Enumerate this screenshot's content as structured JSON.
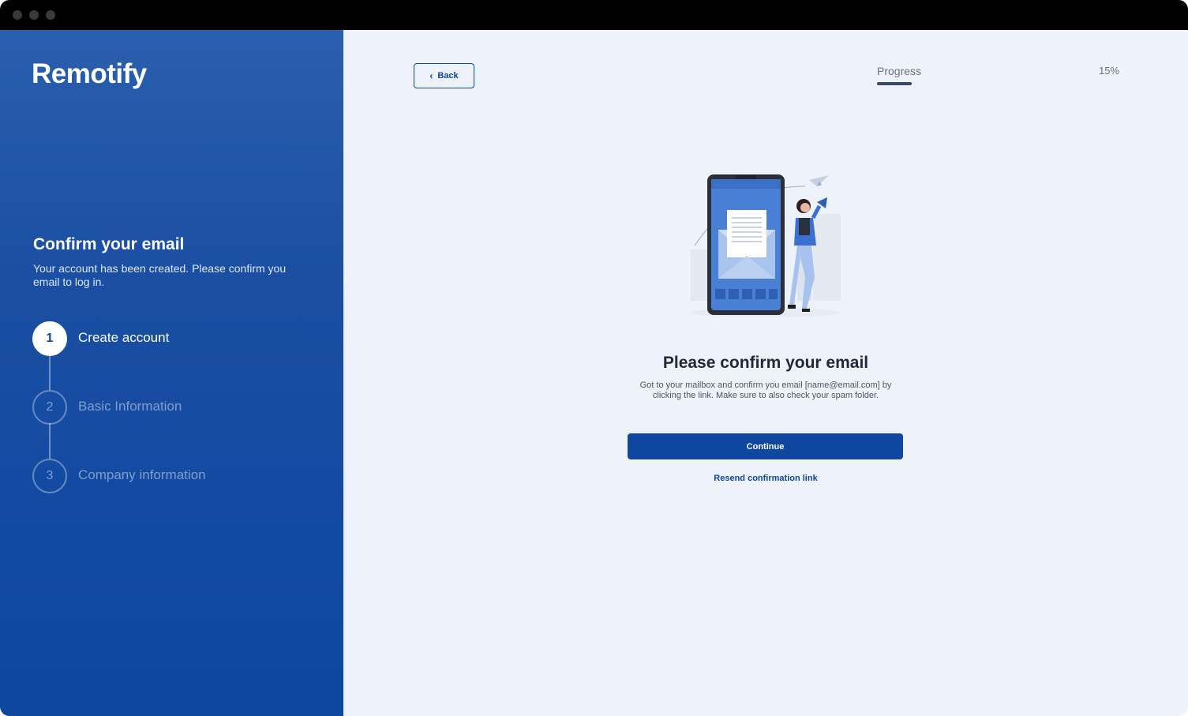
{
  "sidebar": {
    "logo": "Remotify",
    "title": "Confirm your email",
    "description": "Your account has been created. Please confirm you email to log in.",
    "steps": [
      {
        "number": "1",
        "label": "Create account",
        "active": true
      },
      {
        "number": "2",
        "label": "Basic Information",
        "active": false
      },
      {
        "number": "3",
        "label": "Company information",
        "active": false
      }
    ]
  },
  "header": {
    "back_label": "Back",
    "progress_label": "Progress",
    "progress_value": "15%",
    "progress_fraction": 0.15
  },
  "main": {
    "heading": "Please confirm your email",
    "description": "Got to your mailbox and confirm you email [name@email.com] by clicking the link. Make sure to also check your spam folder.",
    "continue_label": "Continue",
    "resend_label": "Resend confirmation link"
  },
  "colors": {
    "primary": "#0e46a0",
    "sidebar_top": "#2a5fae",
    "background": "#eef3fb"
  }
}
